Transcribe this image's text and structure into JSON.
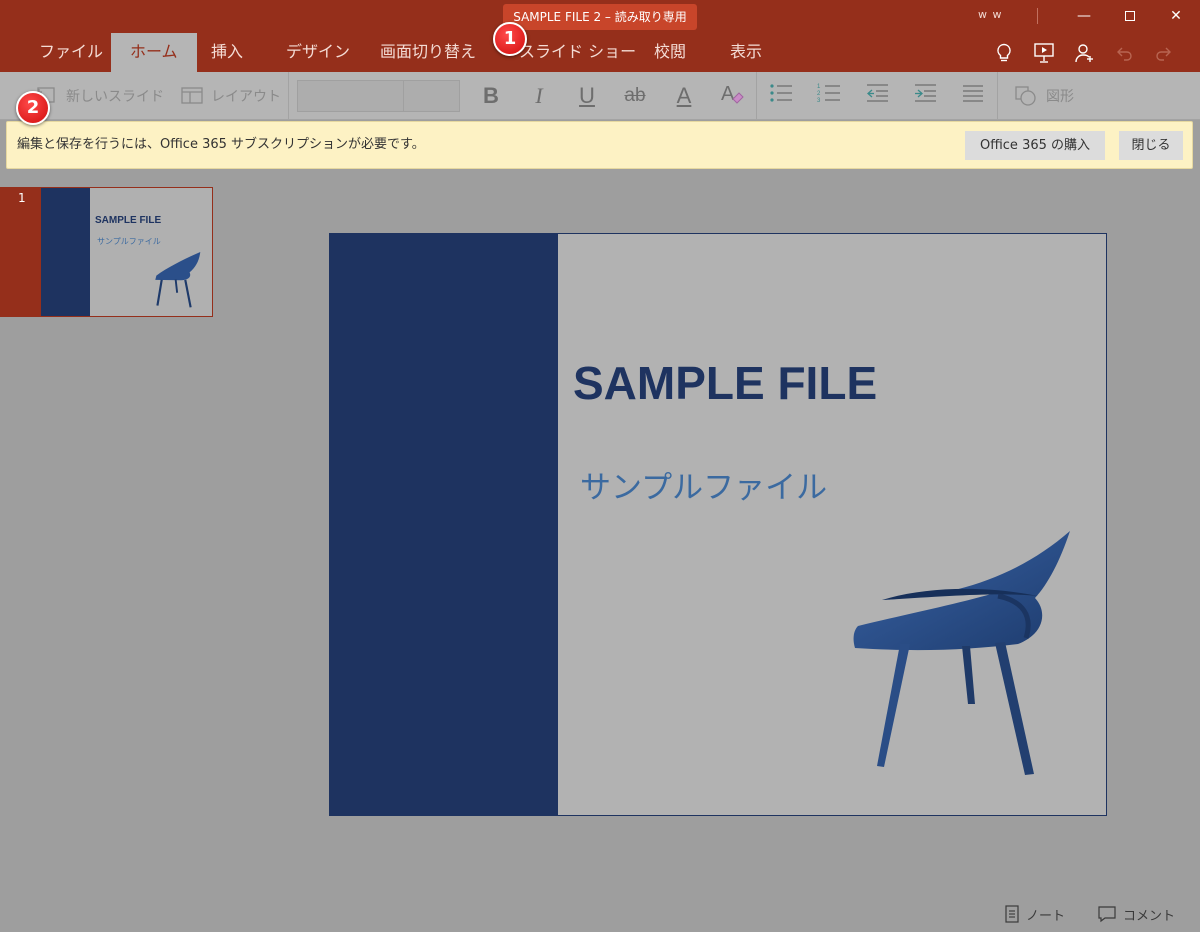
{
  "window": {
    "title": "SAMPLE FILE 2 – 読み取り専用",
    "user": "w w",
    "minimize_glyph": "—",
    "close_glyph": "✕"
  },
  "tabs": [
    {
      "label": "ファイル"
    },
    {
      "label": "ホーム"
    },
    {
      "label": "挿入"
    },
    {
      "label": "デザイン"
    },
    {
      "label": "画面切り替え"
    },
    {
      "label": "スライド ショー"
    },
    {
      "label": "校閲"
    },
    {
      "label": "表示"
    }
  ],
  "active_tab": "ホーム",
  "tab_icons": [
    "lightbulb-icon",
    "present-icon",
    "share-person-icon",
    "undo-icon",
    "redo-icon"
  ],
  "ribbon": {
    "new_slide": "新しいスライド",
    "layout": "レイアウト",
    "font_name": "",
    "font_size": "",
    "bold": "B",
    "italic": "I",
    "underline": "U",
    "strike": "ab",
    "font_color": "A",
    "shapes": "図形"
  },
  "infobar": {
    "message": "編集と保存を行うには、Office 365 サブスクリプションが必要です。",
    "buy_label": "Office 365 の購入",
    "close_label": "閉じる"
  },
  "badges": [
    "1",
    "2"
  ],
  "thumbnail": {
    "number": "1",
    "title": "SAMPLE FILE",
    "subtitle": "サンプルファイル"
  },
  "slide": {
    "title": "SAMPLE FILE",
    "subtitle": "サンプルファイル"
  },
  "statusbar": {
    "notes": "ノート",
    "comments": "コメント"
  },
  "colors": {
    "titlebar": "#952f1b",
    "title_pill": "#c8452a",
    "ribbon": "#b5b5b5",
    "infobar": "#fdf2c4",
    "slide_band": "#1e3360",
    "subtitle": "#3b6aa0",
    "chair": "#2b4f8a",
    "badge": "#e01616"
  }
}
